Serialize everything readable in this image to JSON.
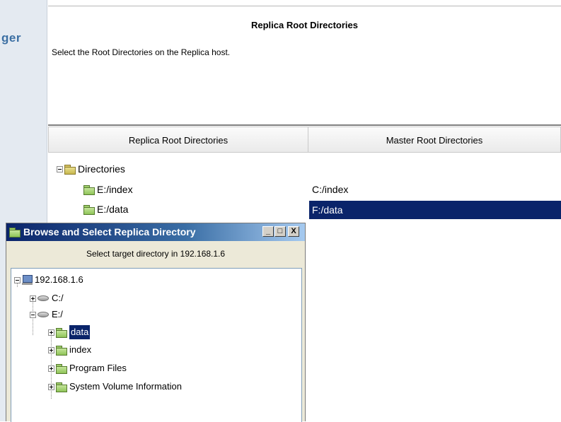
{
  "sidebar": {
    "title_fragment": "ger"
  },
  "wizard": {
    "title": "Replica Root Directories",
    "description": "Select the Root Directories on the Replica host."
  },
  "grid": {
    "columns": [
      "Replica Root Directories",
      "Master Root Directories"
    ],
    "root_label": "Directories",
    "rows": [
      {
        "replica": "E:/index",
        "master": "C:/index",
        "selected": false
      },
      {
        "replica": "E:/data",
        "master": "F:/data",
        "selected": true
      }
    ]
  },
  "dialog": {
    "title": "Browse and Select Replica Directory",
    "subtitle": "Select target directory in 192.168.1.6",
    "buttons": {
      "minimize": "_",
      "maximize": "□",
      "close": "X"
    },
    "tree": {
      "host": "192.168.1.6",
      "drives": [
        "C:/",
        "E:/"
      ],
      "folders": [
        "data",
        "index",
        "Program Files",
        "System Volume Information"
      ],
      "selected_folder": "data"
    }
  },
  "colors": {
    "selection": "#0a246a",
    "sidebar_title": "#3b6fa3",
    "titlebar": "#0a246a"
  },
  "icons": [
    "folder-icon",
    "computer-icon",
    "drive-icon",
    "expander-icon"
  ]
}
